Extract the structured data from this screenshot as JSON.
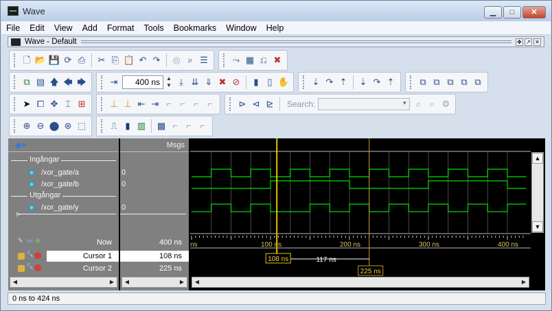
{
  "window": {
    "title": "Wave"
  },
  "menu": [
    "File",
    "Edit",
    "View",
    "Add",
    "Format",
    "Tools",
    "Bookmarks",
    "Window",
    "Help"
  ],
  "subwindow": {
    "title": "Wave - Default"
  },
  "toolbar": {
    "time_value": "400 ns",
    "search_label": "Search:",
    "search_value": ""
  },
  "header": {
    "msgs_label": "Msgs"
  },
  "groups": [
    {
      "label": "Ingångar"
    },
    {
      "label": "Utgångar"
    }
  ],
  "signals": [
    {
      "name": "/xor_gate/a",
      "value": "0"
    },
    {
      "name": "/xor_gate/b",
      "value": "0"
    },
    {
      "name": "/xor_gate/y",
      "value": "0"
    }
  ],
  "now": {
    "label": "Now",
    "value": "400 ns"
  },
  "cursors": [
    {
      "label": "Cursor 1",
      "value": "108 ns",
      "marker": "108 ns"
    },
    {
      "label": "Cursor 2",
      "value": "225 ns",
      "marker": "225 ns"
    }
  ],
  "cursor_delta": "117 ns",
  "timeline": {
    "ticks": [
      "ns",
      "100 ns",
      "200 ns",
      "300 ns",
      "400 ns"
    ],
    "range_ns": [
      0,
      424
    ]
  },
  "waveforms": {
    "a": [
      [
        0,
        0
      ],
      [
        25,
        1
      ],
      [
        50,
        0
      ],
      [
        75,
        1
      ],
      [
        100,
        0
      ],
      [
        125,
        1
      ],
      [
        150,
        0
      ],
      [
        175,
        1
      ],
      [
        200,
        0
      ],
      [
        225,
        1
      ],
      [
        250,
        0
      ],
      [
        275,
        1
      ],
      [
        300,
        0
      ],
      [
        325,
        1
      ],
      [
        350,
        0
      ],
      [
        375,
        1
      ],
      [
        400,
        0
      ]
    ],
    "b": [
      [
        0,
        0
      ],
      [
        50,
        0
      ],
      [
        100,
        1
      ],
      [
        150,
        1
      ],
      [
        200,
        0
      ],
      [
        250,
        0
      ],
      [
        300,
        1
      ],
      [
        350,
        1
      ],
      [
        400,
        0
      ]
    ],
    "y": [
      [
        0,
        0
      ],
      [
        25,
        1
      ],
      [
        50,
        0
      ],
      [
        75,
        1
      ],
      [
        100,
        0
      ],
      [
        150,
        1
      ],
      [
        175,
        0
      ],
      [
        200,
        1
      ],
      [
        225,
        0
      ],
      [
        250,
        1
      ],
      [
        275,
        0
      ],
      [
        300,
        1
      ],
      [
        325,
        0
      ],
      [
        350,
        1
      ],
      [
        375,
        0
      ],
      [
        400,
        1
      ]
    ]
  },
  "colors": {
    "wave": "#00e000",
    "cursor1": "#e6c200",
    "cursor2": "#c89632",
    "grid": "#4a4a4a"
  },
  "status": {
    "range_text": "0 ns to 424 ns"
  }
}
